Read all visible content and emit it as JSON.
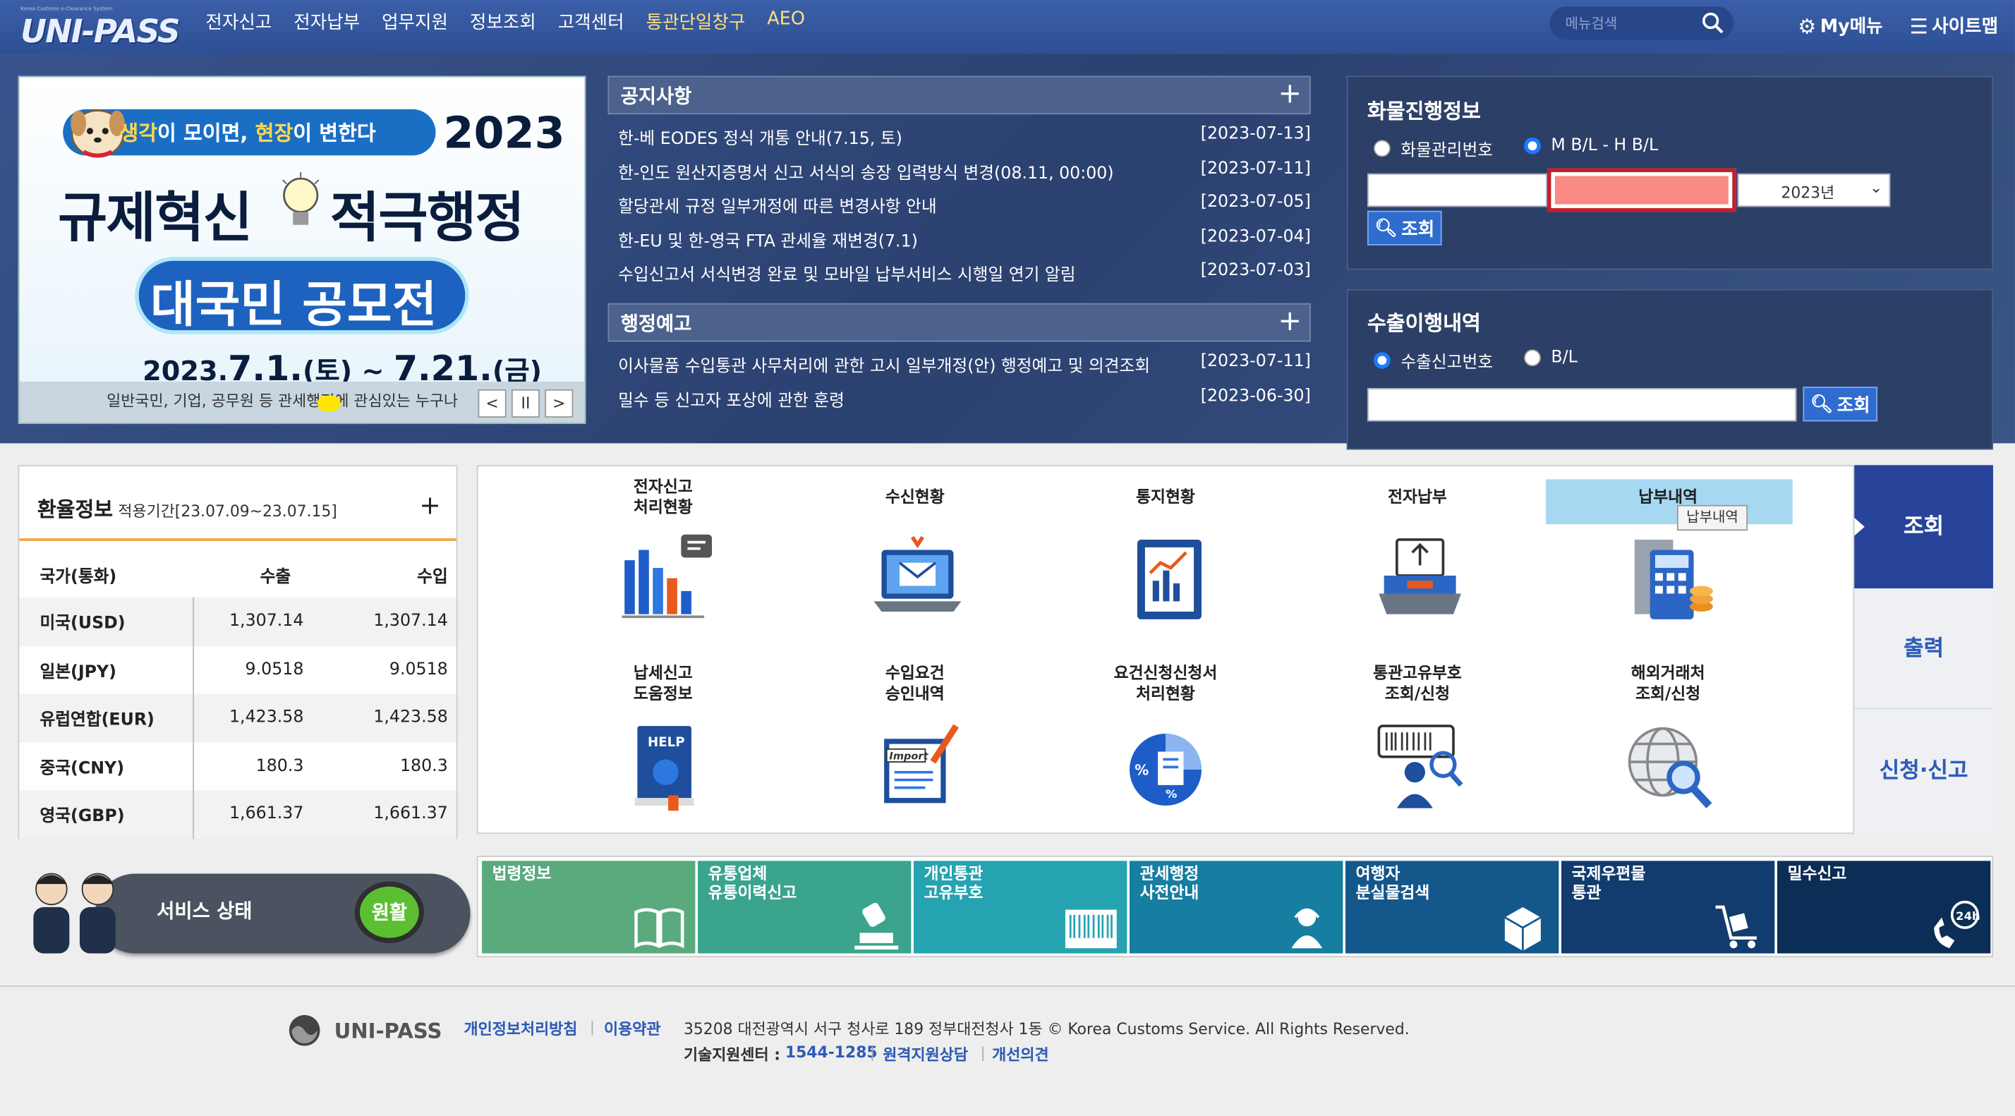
{
  "header": {
    "logo_sub": "Korea Customs e-Clearance System",
    "logo_text": "UNI-PASS",
    "nav": [
      "전자신고",
      "전자납부",
      "업무지원",
      "정보조회",
      "고객센터",
      "통관단일창구",
      "AEO"
    ],
    "search_placeholder": "메뉴검색",
    "mymenu_label": "My메뉴",
    "sitemap_label": "사이트맵"
  },
  "banner": {
    "slogan_a": "생각",
    "slogan_b": "이 모이면, ",
    "slogan_c": "현장",
    "slogan_d": "이 변한다",
    "year": "2023",
    "line2": "규제혁신 ",
    "line2b": " 적극행정",
    "line3": "대국민 공모전",
    "date_a": "2023.",
    "date_b": "7.1.",
    "date_c": "(토) ~ ",
    "date_d": "7.21.",
    "date_e": "(금)",
    "caption": "일반국민, 기업, 공무원 등 관세행정에 관심있는 누구나",
    "controls": [
      "<",
      "II",
      ">"
    ]
  },
  "notices": {
    "title": "공지사항",
    "items": [
      {
        "title": "한-베 EODES 정식 개통 안내(7.15, 토)",
        "date": "[2023-07-13]"
      },
      {
        "title": "한-인도 원산지증명서 신고 서식의 송장 입력방식 변경(08.11, 00:00)",
        "date": "[2023-07-11]"
      },
      {
        "title": "할당관세 규정 일부개정에 따른 변경사항 안내",
        "date": "[2023-07-05]"
      },
      {
        "title": "한-EU 및 한-영국 FTA 관세율 재변경(7.1)",
        "date": "[2023-07-04]"
      },
      {
        "title": "수입신고서 서식변경 완료 및 모바일 납부서비스 시행일 연기 알림",
        "date": "[2023-07-03]"
      }
    ]
  },
  "admin_notice": {
    "title": "행정예고",
    "items": [
      {
        "title": "이사물품 수입통관 사무처리에 관한 고시 일부개정(안) 행정예고 및 의견조회",
        "date": "[2023-07-11]"
      },
      {
        "title": "밀수 등 신고자 포상에 관한 훈령",
        "date": "[2023-06-30]"
      }
    ]
  },
  "cargo": {
    "title": "화물진행정보",
    "radio1": "화물관리번호",
    "radio2": "M B/L - H B/L",
    "year_value": "2023년",
    "button": "조회"
  },
  "export": {
    "title": "수출이행내역",
    "radio1": "수출신고번호",
    "radio2": "B/L",
    "button": "조회"
  },
  "exchange": {
    "title": "환율정보",
    "period": "적용기간[23.07.09~23.07.15]",
    "headers": [
      "국가(통화)",
      "수출",
      "수입"
    ],
    "rows": [
      [
        "미국(USD)",
        "1,307.14",
        "1,307.14"
      ],
      [
        "일본(JPY)",
        "9.0518",
        "9.0518"
      ],
      [
        "유럽연합(EUR)",
        "1,423.58",
        "1,423.58"
      ],
      [
        "중국(CNY)",
        "180.3",
        "180.3"
      ],
      [
        "영국(GBP)",
        "1,661.37",
        "1,661.37"
      ]
    ]
  },
  "service_status": {
    "label": "서비스 상태",
    "value": "원활"
  },
  "quick": [
    {
      "l1": "전자신고",
      "l2": "처리현황",
      "icon": "bar-chart-icon"
    },
    {
      "l1": "수신현황",
      "l2": "",
      "icon": "laptop-mail-icon"
    },
    {
      "l1": "통지현황",
      "l2": "",
      "icon": "report-clipboard-icon"
    },
    {
      "l1": "전자납부",
      "l2": "",
      "icon": "payment-terminal-icon"
    },
    {
      "l1": "납부내역",
      "l2": "",
      "icon": "receipt-calculator-icon"
    },
    {
      "l1": "납세신고",
      "l2": "도움정보",
      "icon": "help-book-icon"
    },
    {
      "l1": "수입요건",
      "l2": "승인내역",
      "icon": "import-document-icon"
    },
    {
      "l1": "요건신청신청서",
      "l2": "처리현황",
      "icon": "percent-pie-icon"
    },
    {
      "l1": "통관고유부호",
      "l2": "조회/신청",
      "icon": "barcode-person-icon"
    },
    {
      "l1": "해외거래처",
      "l2": "조회/신청",
      "icon": "globe-search-icon"
    }
  ],
  "tooltip": "납부내역",
  "side_tabs": [
    "조회",
    "출력",
    "신청·신고"
  ],
  "tiles": [
    {
      "l1": "법령정보",
      "l2": "",
      "color": "#5aaa7e",
      "icon": "book-icon"
    },
    {
      "l1": "유통업체",
      "l2": "유통이력신고",
      "color": "#3aa48d",
      "icon": "stamp-icon"
    },
    {
      "l1": "개인통관",
      "l2": "고유부호",
      "color": "#25a3b0",
      "icon": "barcode-icon"
    },
    {
      "l1": "관세행정",
      "l2": "사전안내",
      "color": "#167ea0",
      "icon": "agent-icon"
    },
    {
      "l1": "여행자",
      "l2": "분실물검색",
      "color": "#14578b",
      "icon": "box-icon"
    },
    {
      "l1": "국제우편물",
      "l2": "통관",
      "color": "#123c6e",
      "icon": "cart-icon"
    },
    {
      "l1": "밀수신고",
      "l2": "",
      "color": "#0c2d55",
      "icon": "phone-24h-icon"
    }
  ],
  "footer": {
    "logo": "UNI-PASS",
    "privacy": "개인정보처리방침",
    "terms": "이용약관",
    "address": "35208 대전광역시 서구 청사로 189 정부대전청사 1동 © Korea Customs Service. All Rights Reserved.",
    "support_label": "기술지원센터 :",
    "support_phone": "1544-1285",
    "remote": "원격지원상담",
    "feedback": "개선의견"
  }
}
